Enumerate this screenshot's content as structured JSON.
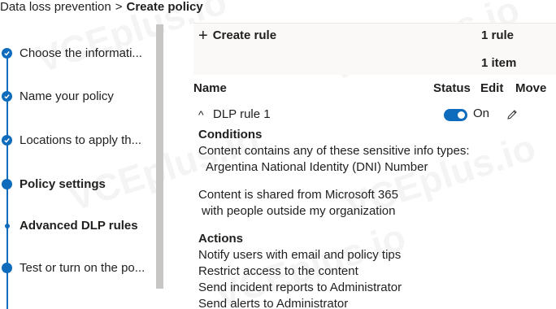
{
  "breadcrumb": {
    "parent": "Data loss prevention",
    "separator": ">",
    "current": "Create policy"
  },
  "wizard": {
    "steps": [
      {
        "label": "Choose the informati...",
        "state": "completed"
      },
      {
        "label": "Name your policy",
        "state": "completed"
      },
      {
        "label": "Locations to apply th...",
        "state": "completed"
      },
      {
        "label": "Policy settings",
        "state": "current"
      },
      {
        "label": "Advanced DLP rules",
        "state": "current-substep"
      },
      {
        "label": "Test or turn on the po...",
        "state": "pending"
      }
    ]
  },
  "toolbar": {
    "create_rule_label": "Create rule",
    "rule_count": "1 rule",
    "item_count": "1 item"
  },
  "table": {
    "columns": {
      "name": "Name",
      "status": "Status",
      "edit": "Edit",
      "move": "Move"
    },
    "rules": [
      {
        "name": "DLP rule 1",
        "status": "On",
        "conditions_heading": "Conditions",
        "conditions": [
          "Content contains any of these sensitive info types:",
          "Argentina National Identity (DNI) Number",
          "Content is shared from Microsoft 365",
          "with people outside my organization"
        ],
        "actions_heading": "Actions",
        "actions": [
          "Notify users with email and policy tips",
          "Restrict access to the content",
          "Send incident reports to Administrator",
          "Send alerts to Administrator"
        ]
      }
    ]
  },
  "watermark": "VCEplus.io",
  "colors": {
    "accent": "#0f6cbd",
    "text": "#201f1e",
    "scrollbar": "#c8c6c4"
  }
}
